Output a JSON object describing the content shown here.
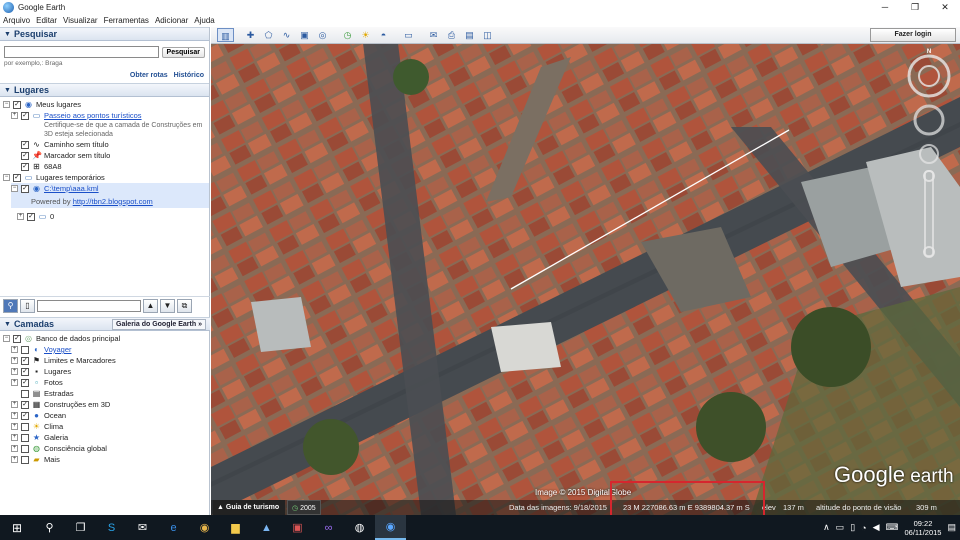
{
  "window": {
    "title": "Google Earth",
    "min": "─",
    "restore": "❐",
    "close": "✕"
  },
  "menu": [
    "Arquivo",
    "Editar",
    "Visualizar",
    "Ferramentas",
    "Adicionar",
    "Ajuda"
  ],
  "search": {
    "header": "Pesquisar",
    "button": "Pesquisar",
    "placeholder": "",
    "hint": "por exemplo,: Braga",
    "link_routes": "Obter rotas",
    "link_history": "Histórico"
  },
  "places": {
    "header": "Lugares",
    "my_places": "Meus lugares",
    "tour": "Passeio aos pontos turísticos",
    "tour_note": "Certifique-se de que a camada de Construções em 3D esteja selecionada",
    "path": "Caminho sem título",
    "marker": "Marcador sem título",
    "item_6a8": "68A8",
    "temp": "Lugares temporários",
    "kml": "C:\\temp\\aaa.kml",
    "powered_prefix": "Powered by",
    "powered_link": "http://tbn2.blogspot.com",
    "zero": "0"
  },
  "layers": {
    "header": "Camadas",
    "gallery": "Galeria do Google Earth",
    "db": "Banco de dados principal",
    "items": [
      "Voyager",
      "Limites e Marcadores",
      "Lugares",
      "Fotos",
      "Estradas",
      "Construções em 3D",
      "Ocean",
      "Clima",
      "Galeria",
      "Consciência global",
      "Mais"
    ]
  },
  "toolbar": {
    "login": "Fazer login"
  },
  "map": {
    "logo_google": "Google",
    "logo_earth": " earth",
    "copyright": "Image © 2015 DigitalGlobe",
    "tour_tab": "Guia de turismo",
    "year": "2005",
    "image_date": "Data das imagens: 9/18/2015",
    "coords": "23 M 227086.63 m E 9389804.37 m S",
    "elev_label": "elev",
    "elev": "137 m",
    "eye_label": "altitude do ponto de visão",
    "eye": "309 m",
    "compass_n": "N"
  },
  "taskbar": {
    "time": "09:22",
    "date": "06/11/2015"
  }
}
